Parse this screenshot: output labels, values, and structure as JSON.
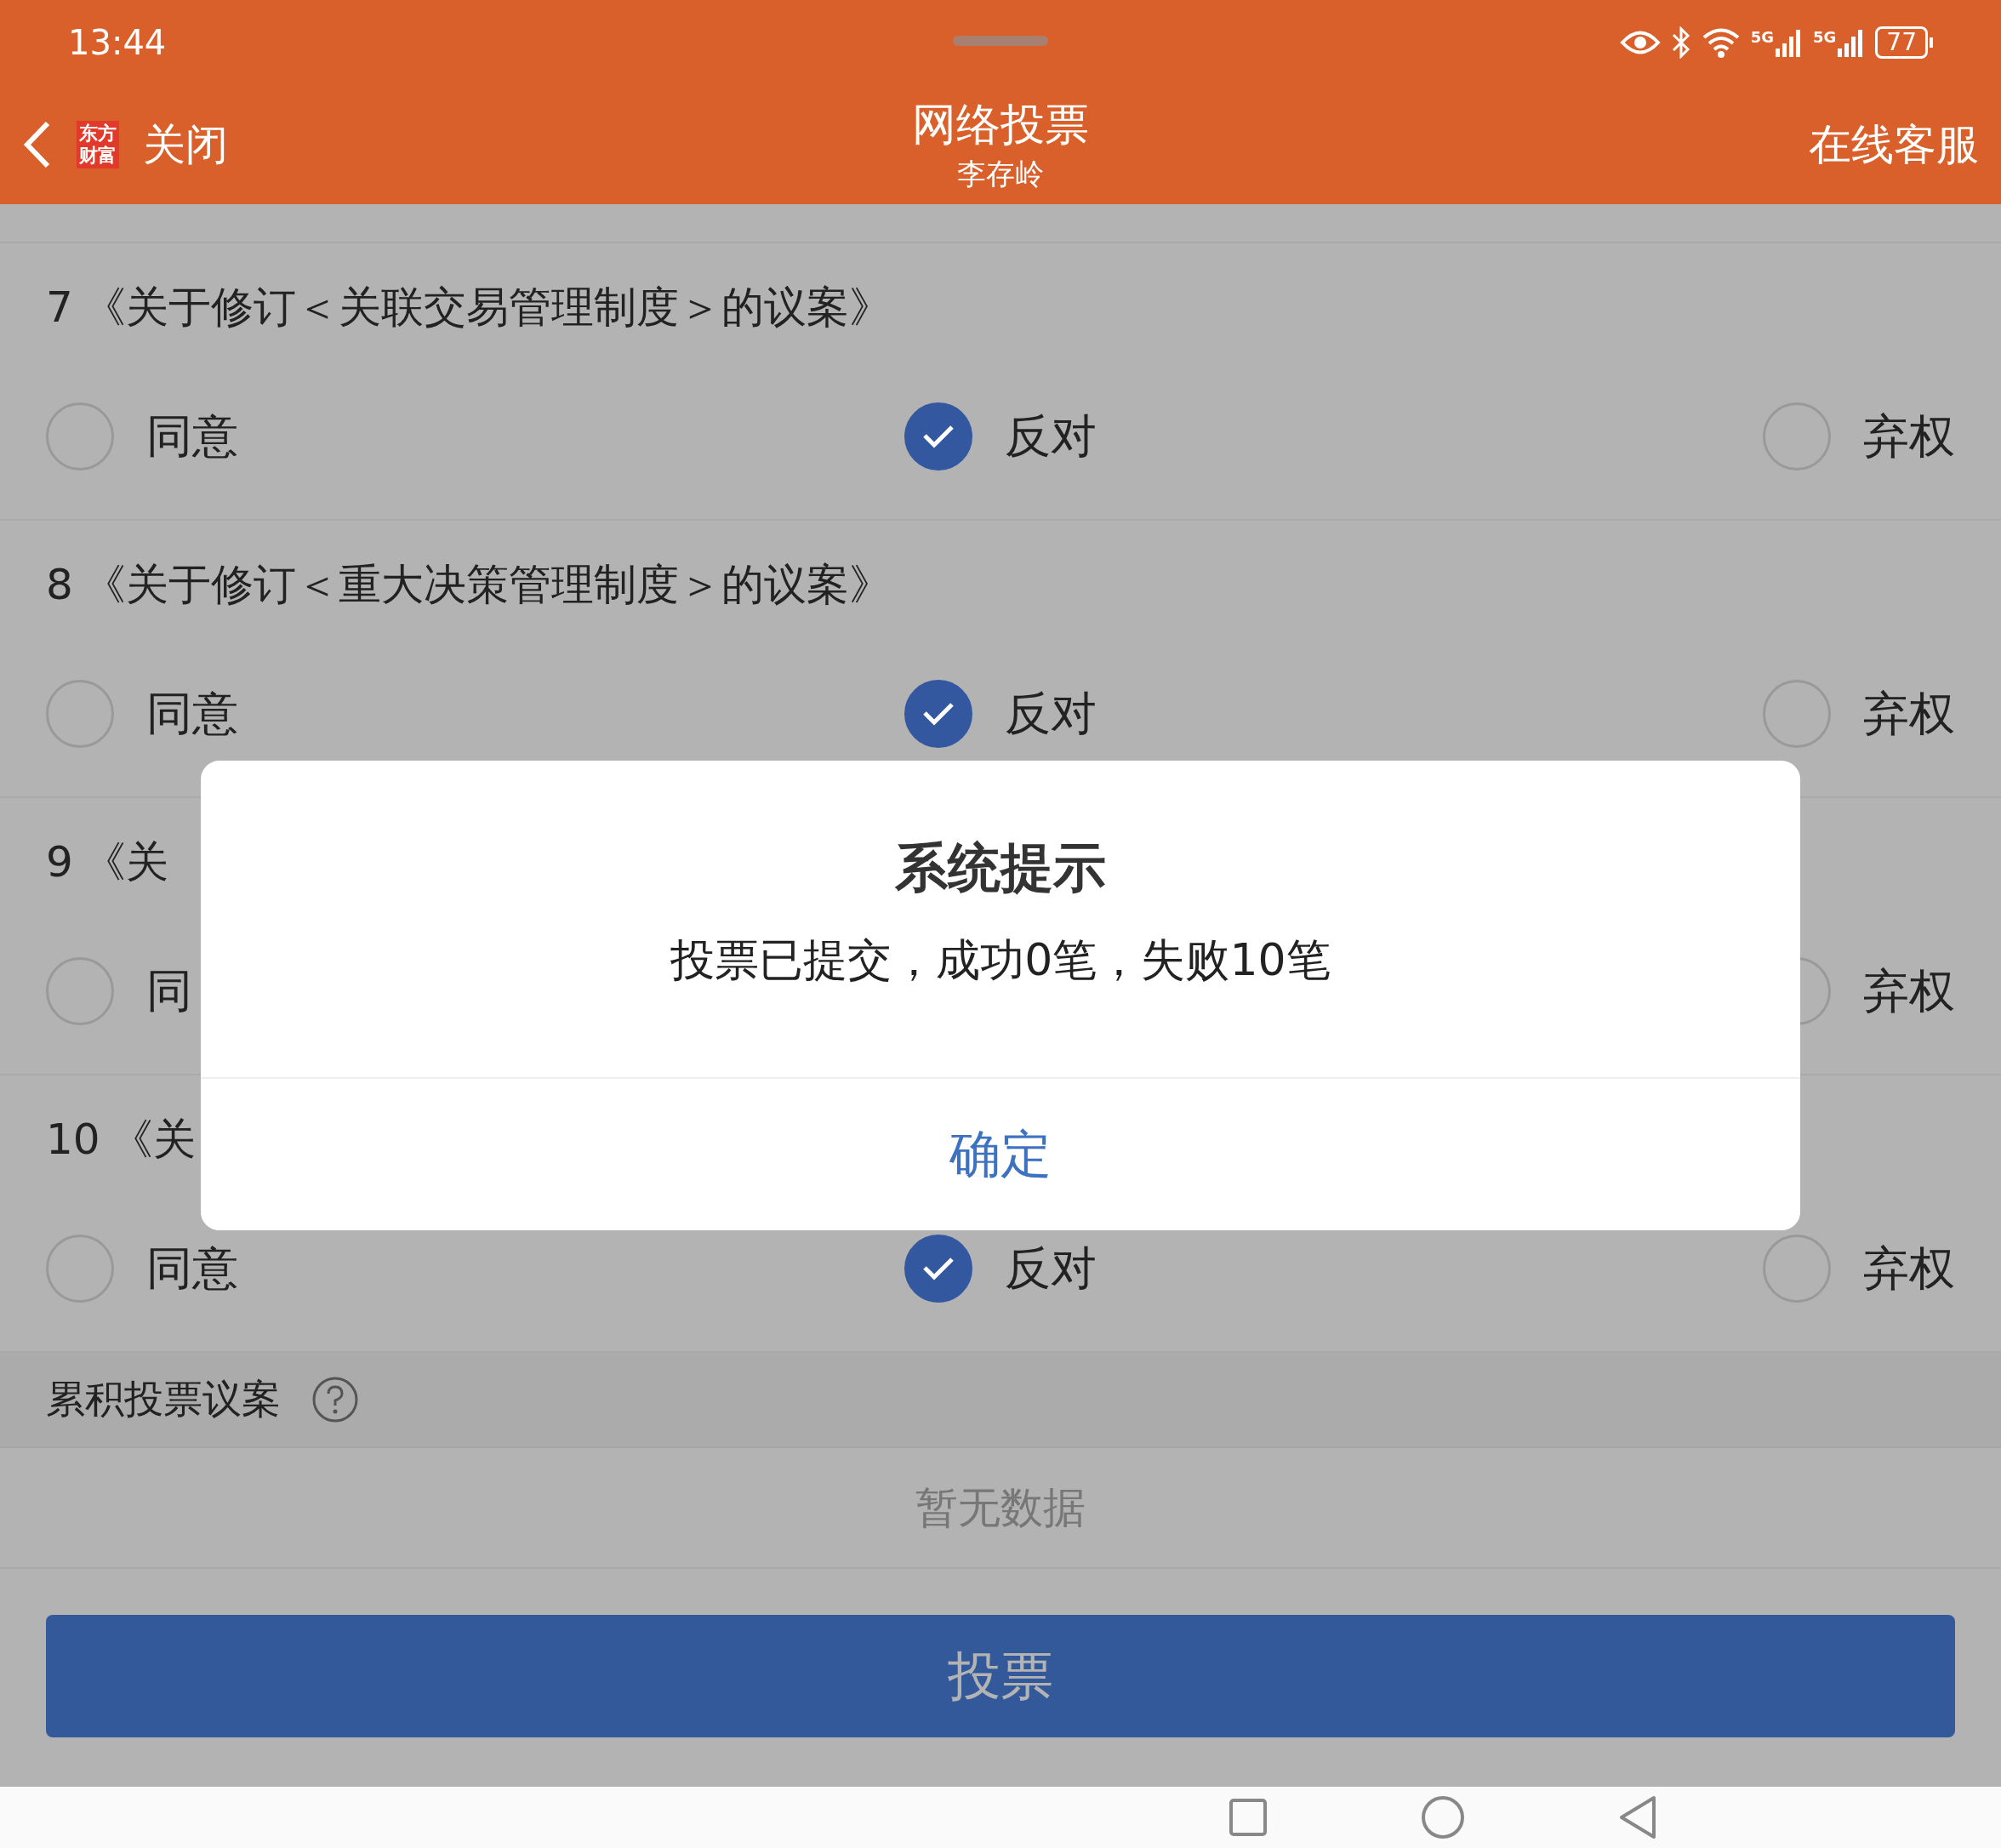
{
  "status_bar": {
    "time": "13:44",
    "network_1": "5G",
    "network_2": "5G",
    "battery": "77"
  },
  "header": {
    "back_label": "关闭",
    "logo_lines": [
      "东方",
      "财富"
    ],
    "title": "网络投票",
    "subtitle": "李存岭",
    "action": "在线客服"
  },
  "proposals": [
    {
      "number": "7",
      "title": "《关于修订＜关联交易管理制度＞的议案》",
      "options": [
        {
          "kind": "agree",
          "label": "同意",
          "selected": false
        },
        {
          "kind": "against",
          "label": "反对",
          "selected": true
        },
        {
          "kind": "abstain",
          "label": "弃权",
          "selected": false
        }
      ]
    },
    {
      "number": "8",
      "title": "《关于修订＜重大决策管理制度＞的议案》",
      "options": [
        {
          "kind": "agree",
          "label": "同意",
          "selected": false
        },
        {
          "kind": "against",
          "label": "反对",
          "selected": true
        },
        {
          "kind": "abstain",
          "label": "弃权",
          "selected": false
        }
      ]
    },
    {
      "number": "9",
      "title": "《关",
      "options": [
        {
          "kind": "agree",
          "label": "同",
          "selected": false
        },
        {
          "kind": "abstain",
          "label": "弃权",
          "selected": false
        }
      ]
    },
    {
      "number": "10",
      "title": "《关",
      "options": [
        {
          "kind": "agree",
          "label": "同意",
          "selected": false
        },
        {
          "kind": "against",
          "label": "反对",
          "selected": true
        },
        {
          "kind": "abstain",
          "label": "弃权",
          "selected": false
        }
      ]
    }
  ],
  "cumulative": {
    "label": "累积投票议案",
    "empty_text": "暂无数据"
  },
  "vote_button": "投票",
  "dialog": {
    "title": "系统提示",
    "message": "投票已提交，成功0笔，失败10笔",
    "confirm": "确定"
  }
}
